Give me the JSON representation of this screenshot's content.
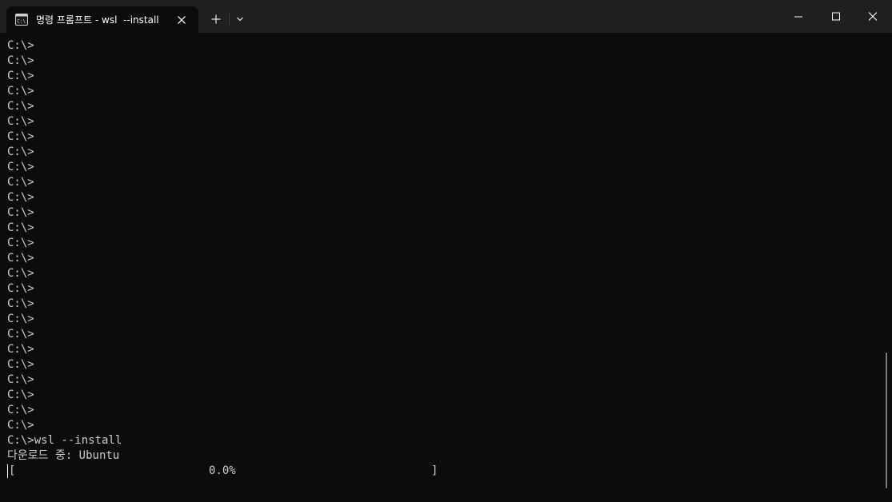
{
  "window": {
    "tab_title": "명령 프롬프트 - wsl  --install",
    "tab_icon": "cmd-icon"
  },
  "terminal": {
    "lines": [
      "C:\\>",
      "C:\\>",
      "C:\\>",
      "C:\\>",
      "C:\\>",
      "C:\\>",
      "C:\\>",
      "C:\\>",
      "C:\\>",
      "C:\\>",
      "C:\\>",
      "C:\\>",
      "C:\\>",
      "C:\\>",
      "C:\\>",
      "C:\\>",
      "C:\\>",
      "C:\\>",
      "C:\\>",
      "C:\\>",
      "C:\\>",
      "C:\\>",
      "C:\\>",
      "C:\\>",
      "C:\\>",
      "C:\\>",
      "C:\\>wsl --install",
      "다운로드 중: Ubuntu"
    ],
    "progress": {
      "open_bracket": "[",
      "percent_text": "0.0%",
      "close_bracket": "]",
      "value": 0.0
    }
  },
  "colors": {
    "background": "#0c0c0c",
    "titlebar": "#1f1f1f",
    "text": "#cccccc"
  }
}
